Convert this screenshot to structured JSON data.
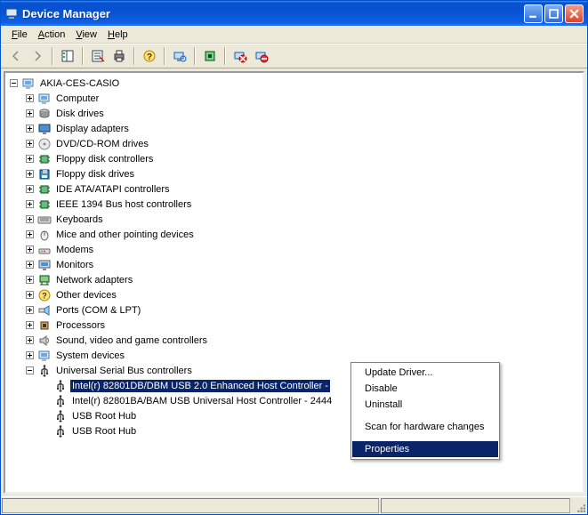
{
  "title": "Device Manager",
  "menu": {
    "file": "File",
    "action": "Action",
    "view": "View",
    "help": "Help"
  },
  "tree": {
    "root": "AKIA-CES-CASIO",
    "categories": [
      "Computer",
      "Disk drives",
      "Display adapters",
      "DVD/CD-ROM drives",
      "Floppy disk controllers",
      "Floppy disk drives",
      "IDE ATA/ATAPI controllers",
      "IEEE 1394 Bus host controllers",
      "Keyboards",
      "Mice and other pointing devices",
      "Modems",
      "Monitors",
      "Network adapters",
      "Other devices",
      "Ports (COM & LPT)",
      "Processors",
      "Sound, video and game controllers",
      "System devices",
      "Universal Serial Bus controllers"
    ],
    "usb_children": [
      "Intel(r) 82801DB/DBM USB 2.0 Enhanced Host Controller - ",
      "Intel(r) 82801BA/BAM USB Universal Host Controller - 2444",
      "USB Root Hub",
      "USB Root Hub"
    ],
    "selected_index": 0
  },
  "context_menu": {
    "items": [
      "Update Driver...",
      "Disable",
      "Uninstall",
      "Scan for hardware changes",
      "Properties"
    ],
    "selected": "Properties"
  },
  "icons": {
    "computer": "computer",
    "disk": "disk",
    "display": "display",
    "dvd": "dvd",
    "floppyctl": "chip",
    "floppy": "floppy",
    "ide": "chip",
    "ieee": "chip",
    "keyboard": "keyboard",
    "mouse": "mouse",
    "modem": "modem",
    "monitor": "monitor",
    "network": "network",
    "other": "question",
    "port": "port",
    "cpu": "cpu",
    "sound": "sound",
    "system": "computer",
    "usb": "usb"
  },
  "colors": {
    "titlebar": "#0851d0",
    "selection": "#0a246a",
    "chrome": "#ece9d8"
  }
}
